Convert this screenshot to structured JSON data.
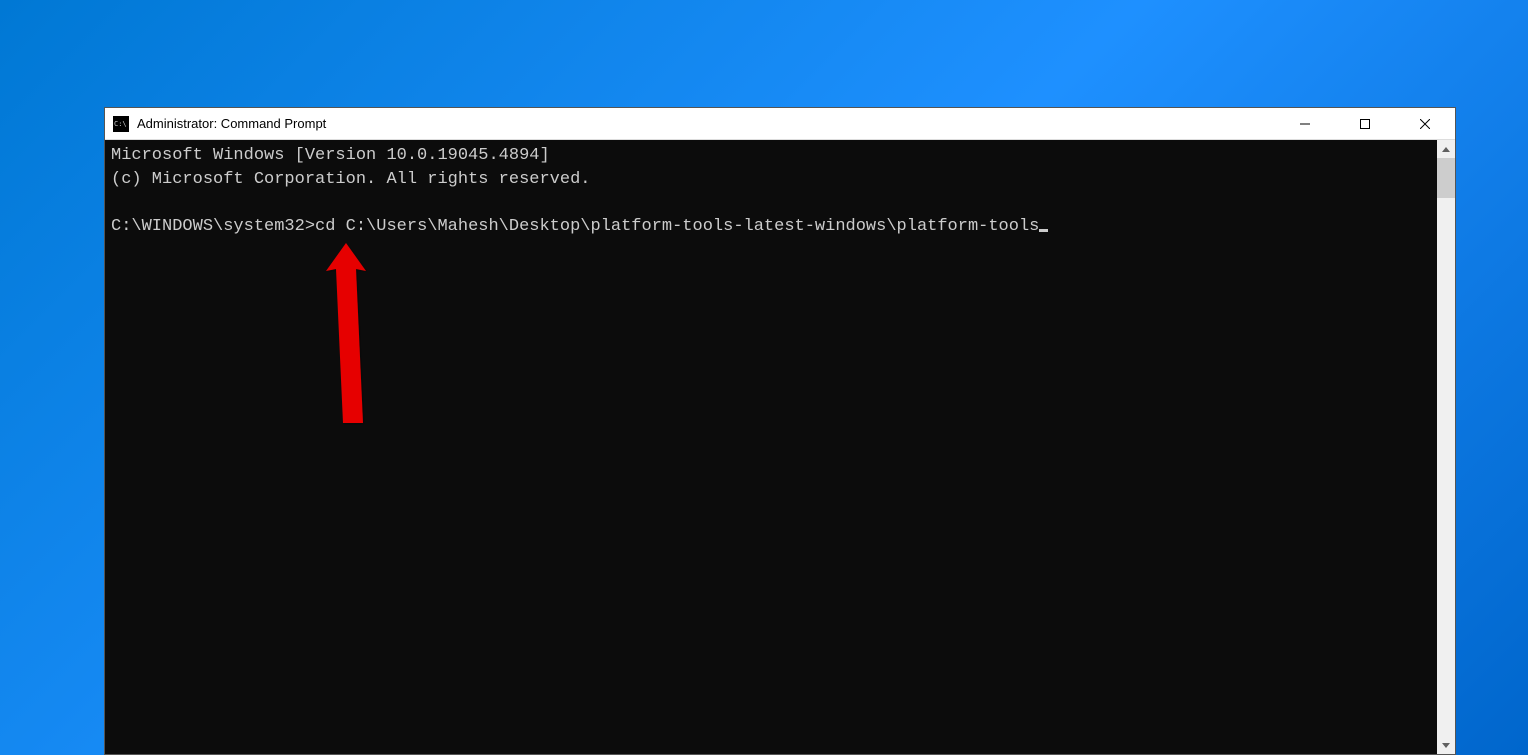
{
  "window": {
    "title": "Administrator: Command Prompt"
  },
  "terminal": {
    "line1": "Microsoft Windows [Version 10.0.19045.4894]",
    "line2": "(c) Microsoft Corporation. All rights reserved.",
    "blank": "",
    "prompt": "C:\\WINDOWS\\system32>",
    "command": "cd C:\\Users\\Mahesh\\Desktop\\platform-tools-latest-windows\\platform-tools"
  },
  "annotation": {
    "arrow_color": "#e60000"
  }
}
